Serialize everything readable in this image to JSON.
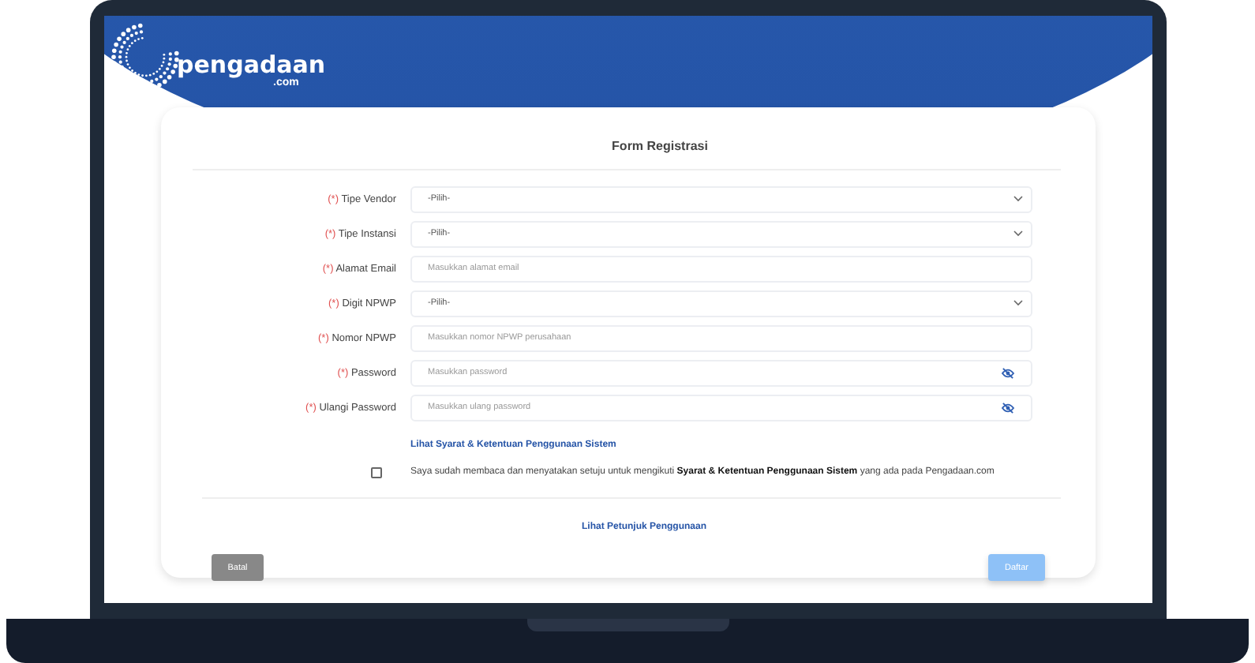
{
  "logo": {
    "name": "pengadaan",
    "suffix": ".com"
  },
  "form": {
    "title": "Form Registrasi",
    "fields": [
      {
        "kind": "select",
        "required_mark": "(*)",
        "label": "Tipe Vendor",
        "value": "-Pilih-"
      },
      {
        "kind": "select",
        "required_mark": "(*)",
        "label": "Tipe Instansi",
        "value": "-Pilih-"
      },
      {
        "kind": "text",
        "required_mark": "(*)",
        "label": "Alamat Email",
        "placeholder": "Masukkan alamat email"
      },
      {
        "kind": "select",
        "required_mark": "(*)",
        "label": "Digit NPWP",
        "value": "-Pilih-"
      },
      {
        "kind": "text",
        "required_mark": "(*)",
        "label": "Nomor NPWP",
        "placeholder": "Masukkan nomor NPWP perusahaan"
      },
      {
        "kind": "password",
        "required_mark": "(*)",
        "label": "Password",
        "placeholder": "Masukkan password"
      },
      {
        "kind": "password",
        "required_mark": "(*)",
        "label": "Ulangi Password",
        "placeholder": "Masukkan ulang password"
      }
    ],
    "terms_link": "Lihat Syarat & Ketentuan Penggunaan Sistem",
    "agreement": {
      "checked": false,
      "text": "Saya sudah membaca dan menyatakan setuju untuk mengikuti **Syarat & Ketentuan Penggunaan Sistem** yang ada pada Pengadaan.com"
    },
    "guide_link": "Lihat Petunjuk Penggunaan",
    "cancel_button": "Batal",
    "submit_button": {
      "label": "Daftar",
      "disabled": true
    }
  }
}
